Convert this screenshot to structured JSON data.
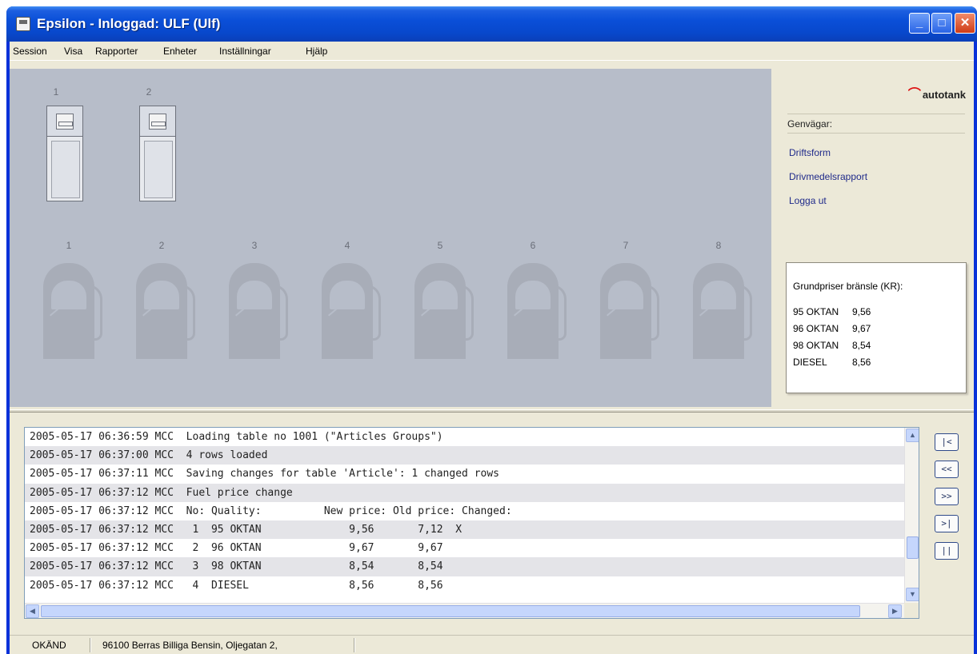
{
  "window": {
    "title": "Epsilon - Inloggad:  ULF (Ulf)"
  },
  "menu": {
    "items": [
      "Session",
      "Visa",
      "Rapporter",
      "Enheter",
      "Inställningar",
      "Hjälp"
    ]
  },
  "dispensers": {
    "numbers": [
      "1",
      "2"
    ]
  },
  "tanks": {
    "numbers": [
      "1",
      "2",
      "3",
      "4",
      "5",
      "6",
      "7",
      "8"
    ]
  },
  "sidebar": {
    "logo_text": "autotank",
    "shortcuts_heading": "Genvägar:",
    "links": [
      "Driftsform",
      "Drivmedelsrapport",
      "Logga ut"
    ],
    "price_box": {
      "title": "Grundpriser bränsle (KR):",
      "rows": [
        {
          "name": "95 OKTAN",
          "price": "9,56"
        },
        {
          "name": "96 OKTAN",
          "price": "9,67"
        },
        {
          "name": "98 OKTAN",
          "price": "8,54"
        },
        {
          "name": "DIESEL",
          "price": "8,56"
        }
      ]
    }
  },
  "log": {
    "rows": [
      "2005-05-17 06:36:59 MCC  Loading table no 1001 (\"Articles Groups\")",
      "2005-05-17 06:37:00 MCC  4 rows loaded",
      "2005-05-17 06:37:11 MCC  Saving changes for table 'Article': 1 changed rows",
      "2005-05-17 06:37:12 MCC  Fuel price change",
      "2005-05-17 06:37:12 MCC  No: Quality:          New price: Old price: Changed:",
      "2005-05-17 06:37:12 MCC   1  95 OKTAN              9,56       7,12  X",
      "2005-05-17 06:37:12 MCC   2  96 OKTAN              9,67       9,67",
      "2005-05-17 06:37:12 MCC   3  98 OKTAN              8,54       8,54",
      "2005-05-17 06:37:12 MCC   4  DIESEL                8,56       8,56"
    ]
  },
  "nav_buttons": [
    "|<",
    "<<",
    ">>",
    ">|",
    "||"
  ],
  "status": {
    "cell1": "OKÄND",
    "cell2": "96100 Berras Billiga Bensin, Oljegatan 2,"
  }
}
